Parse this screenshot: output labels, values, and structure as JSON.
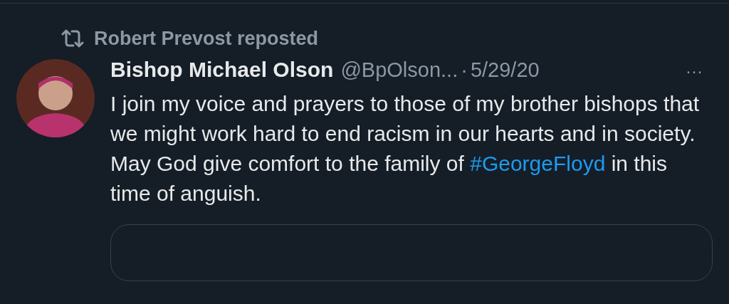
{
  "repost": {
    "label": "Robert Prevost reposted"
  },
  "post": {
    "author": "Bishop Michael Olson",
    "handle": "@BpOlson...",
    "separator": "·",
    "date": "5/29/20",
    "more": "···",
    "body": [
      {
        "kind": "text",
        "text": "I join my voice and prayers to those of my brother bishops that we might work hard to end racism in our hearts and in society. May God give comfort to the family of "
      },
      {
        "kind": "hashtag",
        "text": "#GeorgeFloyd"
      },
      {
        "kind": "text",
        "text": " in this time of anguish."
      }
    ],
    "quote": {
      "kind": "card"
    }
  }
}
